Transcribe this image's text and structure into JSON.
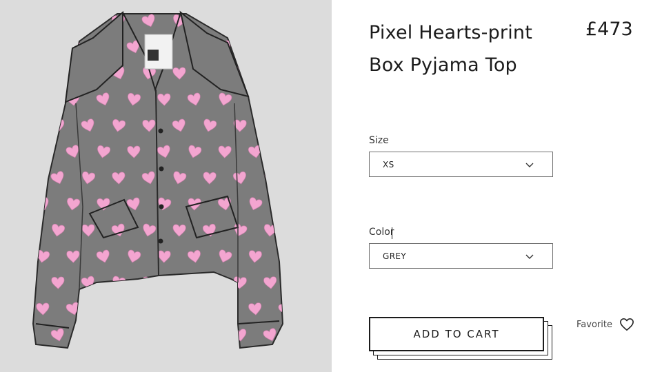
{
  "product": {
    "title": "Pixel Hearts-print Box Pyjama Top",
    "price": "£473",
    "image": {
      "garment_color": "#7c7c7c",
      "heart_color": "#f3a5d0",
      "panel_background": "#dcdcdc"
    }
  },
  "size": {
    "label": "Size",
    "selected": "XS"
  },
  "color": {
    "label": "Color",
    "selected": "GREY"
  },
  "actions": {
    "add_to_cart": "ADD TO CART",
    "favorite": "Favorite"
  },
  "icons": {
    "dropdown": "chevron-down-icon",
    "favorite": "heart-outline-icon"
  }
}
